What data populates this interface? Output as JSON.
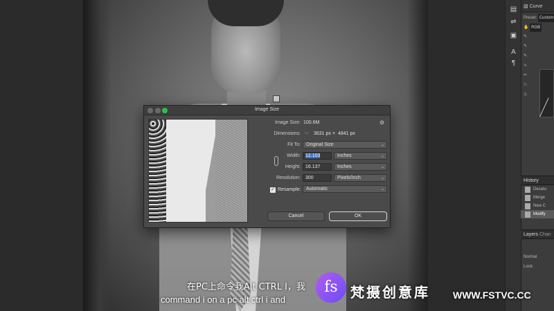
{
  "dialog": {
    "title": "Image Size",
    "image_size_label": "Image Size:",
    "image_size_value": "100.6M",
    "dimensions_label": "Dimensions:",
    "dimensions_w": "3631 px",
    "dimensions_x": "×",
    "dimensions_h": "4841 px",
    "fit_to_label": "Fit To:",
    "fit_to_value": "Original Size",
    "width_label": "Width:",
    "width_value": "12.103",
    "width_unit": "Inches",
    "height_label": "Height:",
    "height_value": "16.137",
    "height_unit": "Inches",
    "resolution_label": "Resolution:",
    "resolution_value": "300",
    "resolution_unit": "Pixels/Inch",
    "resample_label": "Resample:",
    "resample_checked": "✓",
    "resample_value": "Automatic",
    "cancel_label": "Cancel",
    "ok_label": "OK",
    "gear_glyph": "⚙"
  },
  "panels": {
    "properties_tab": "Curve",
    "preset_label": "Preset:",
    "preset_value": "Custom",
    "channel_value": "RGB",
    "history_title": "History",
    "history_items": [
      "Desatu",
      "Merge",
      "New C",
      "Modify"
    ],
    "layers_tab": "Layers",
    "channels_tab": "Chan",
    "blend_mode": "Normal",
    "lock_label": "Lock:"
  },
  "subtitles": {
    "line1": "在PC上命令我Alt CTRL I，我",
    "line2": "command i on a pc alt ctrl i and"
  },
  "watermark": {
    "logo_text": "fs",
    "name": "梵摄创意库",
    "url": "WWW.FSTVC.CC"
  }
}
